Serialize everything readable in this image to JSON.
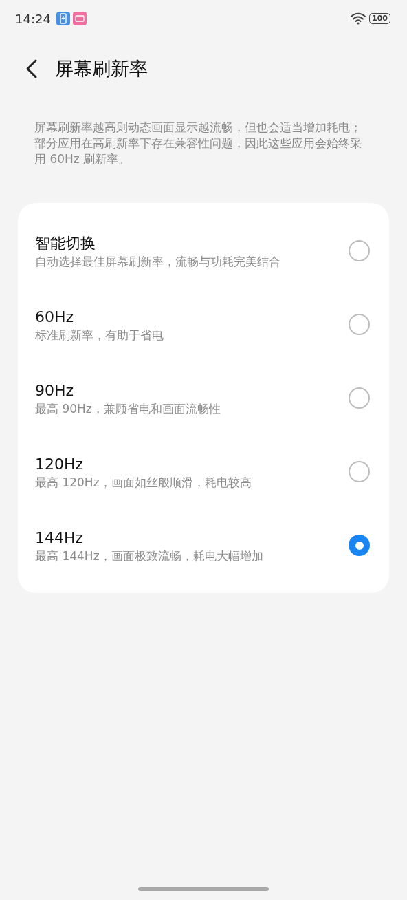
{
  "status_bar": {
    "time": "14:24",
    "battery": "100"
  },
  "header": {
    "title": "屏幕刷新率"
  },
  "description": "屏幕刷新率越高则动态画面显示越流畅，但也会适当增加耗电；部分应用在高刷新率下存在兼容性问题，因此这些应用会始终采用 60Hz 刷新率。",
  "options": [
    {
      "title": "智能切换",
      "subtitle": "自动选择最佳屏幕刷新率，流畅与功耗完美结合",
      "selected": false
    },
    {
      "title": "60Hz",
      "subtitle": "标准刷新率，有助于省电",
      "selected": false
    },
    {
      "title": "90Hz",
      "subtitle": "最高 90Hz，兼顾省电和画面流畅性",
      "selected": false
    },
    {
      "title": "120Hz",
      "subtitle": "最高 120Hz，画面如丝般顺滑，耗电较高",
      "selected": false
    },
    {
      "title": "144Hz",
      "subtitle": "最高 144Hz，画面极致流畅，耗电大幅增加",
      "selected": true
    }
  ]
}
